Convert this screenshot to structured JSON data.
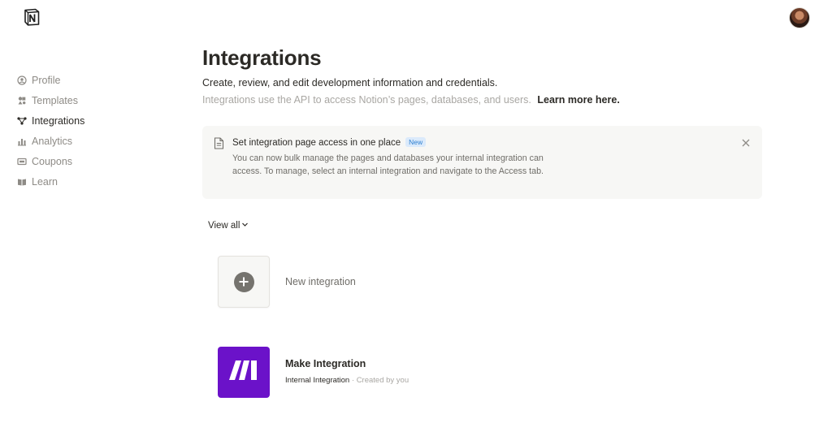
{
  "header": {
    "logo_icon": "notion-logo-icon",
    "avatar_icon": "user-avatar"
  },
  "sidebar": {
    "items": [
      {
        "label": "Profile",
        "icon": "user-circle-icon",
        "active": false
      },
      {
        "label": "Templates",
        "icon": "shapes-icon",
        "active": false
      },
      {
        "label": "Integrations",
        "icon": "nodes-icon",
        "active": true
      },
      {
        "label": "Analytics",
        "icon": "bar-chart-icon",
        "active": false
      },
      {
        "label": "Coupons",
        "icon": "ticket-icon",
        "active": false
      },
      {
        "label": "Learn",
        "icon": "book-icon",
        "active": false
      }
    ]
  },
  "main": {
    "title": "Integrations",
    "subtitle": "Create, review, and edit development information and credentials.",
    "description": "Integrations use the API to access Notion’s pages, databases, and users.",
    "learn_more": "Learn more here."
  },
  "banner": {
    "title": "Set integration page access in one place",
    "badge": "New",
    "body": "You can now bulk manage the pages and databases your internal integration can access. To manage, select an internal integration and navigate to the Access tab.",
    "close_icon": "close-icon"
  },
  "filter": {
    "view_all": "View all"
  },
  "integrations": {
    "new_label": "New integration",
    "items": [
      {
        "name": "Make Integration",
        "type": "Internal Integration",
        "separator": "·",
        "creator": "Created by you",
        "color": "#6b12c9"
      }
    ]
  },
  "colors": {
    "text_primary": "#2c2a26",
    "text_muted": "#8e8b86",
    "banner_bg": "#f7f7f5",
    "badge_text": "#2f80d0",
    "badge_bg": "#dbeafb",
    "make_brand": "#6b12c9"
  }
}
